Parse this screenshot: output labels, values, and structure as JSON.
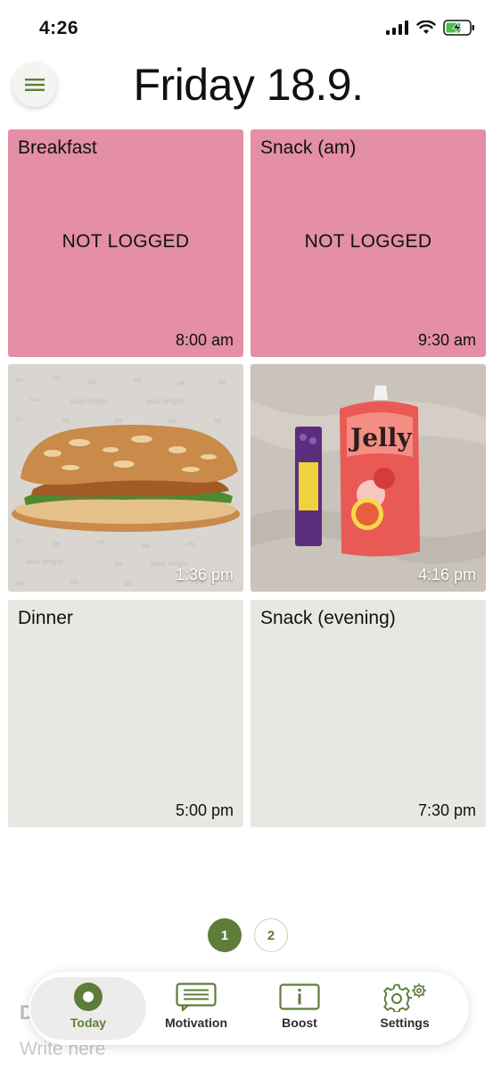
{
  "status_bar": {
    "time": "4:26"
  },
  "header": {
    "title": "Friday 18.9.",
    "menu_icon": "hamburger-icon"
  },
  "meals": [
    {
      "label": "Breakfast",
      "status": "NOT LOGGED",
      "time": "8:00 am",
      "state": "not-logged"
    },
    {
      "label": "Snack (am)",
      "status": "NOT LOGGED",
      "time": "9:30 am",
      "state": "not-logged"
    },
    {
      "label": "",
      "status": "",
      "time": "1:36 pm",
      "state": "photo",
      "photo": "chicken-sandwich"
    },
    {
      "label": "",
      "status": "",
      "time": "4:16 pm",
      "state": "photo",
      "photo": "jelly-snacks"
    },
    {
      "label": "Dinner",
      "status": "",
      "time": "5:00 pm",
      "state": "upcoming"
    },
    {
      "label": "Snack (evening)",
      "status": "",
      "time": "7:30 pm",
      "state": "upcoming"
    }
  ],
  "pager": {
    "pages": [
      "1",
      "2"
    ],
    "active": "1"
  },
  "note": {
    "heading": "D",
    "placeholder": "Write here"
  },
  "nav": {
    "today": "Today",
    "motivation": "Motivation",
    "boost": "Boost",
    "settings": "Settings",
    "active": "Today"
  },
  "colors": {
    "accent": "#5e7d3a",
    "not_logged": "#e48fa6",
    "upcoming": "#e8e8e3"
  }
}
